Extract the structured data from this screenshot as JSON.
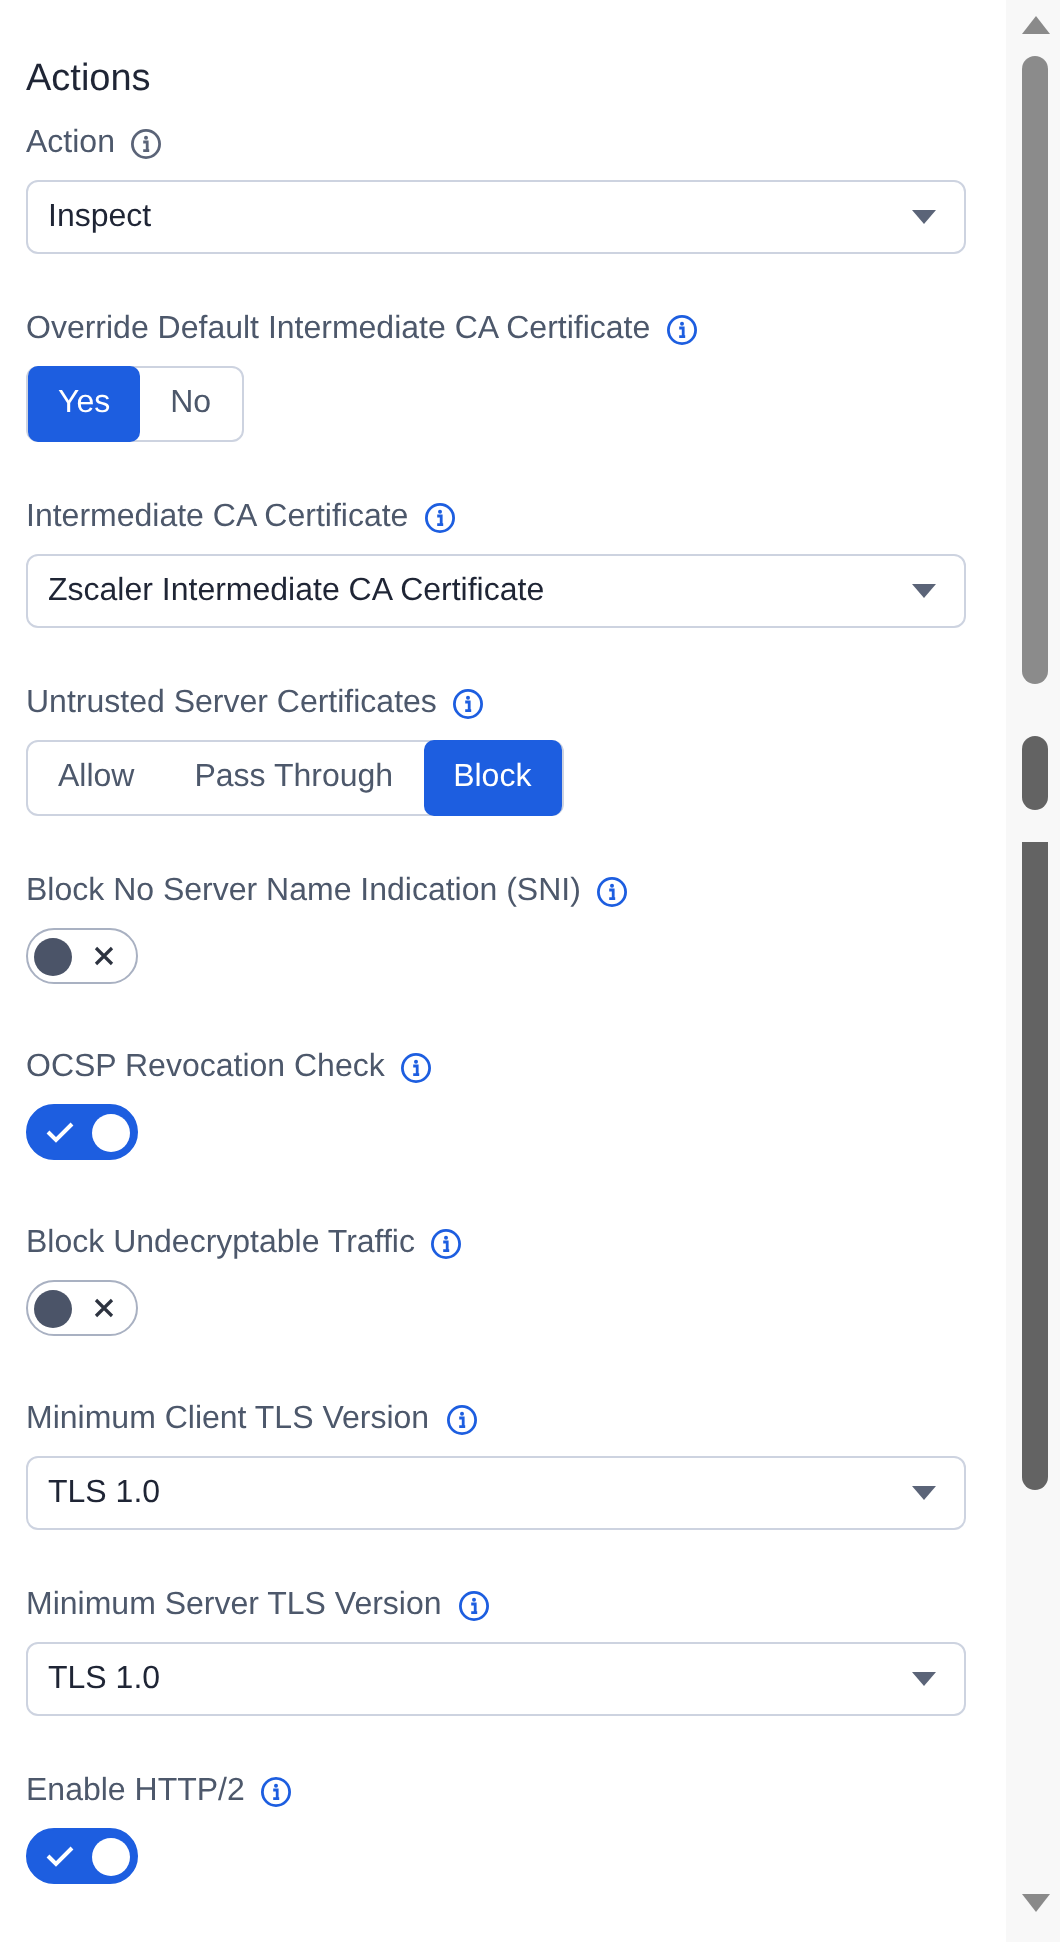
{
  "section_title": "Actions",
  "fields": [
    {
      "kind": "select",
      "label": "Action",
      "info_icon": {
        "color": "#5b6478"
      },
      "value": "Inspect"
    },
    {
      "kind": "segmented",
      "label": "Override Default Intermediate CA Certificate",
      "info_icon": {
        "color": "#1d5ee0"
      },
      "options": [
        {
          "label": "Yes",
          "selected": true
        },
        {
          "label": "No",
          "selected": false
        }
      ]
    },
    {
      "kind": "select",
      "label": "Intermediate CA Certificate",
      "info_icon": {
        "color": "#1d5ee0"
      },
      "value": "Zscaler Intermediate CA Certificate"
    },
    {
      "kind": "segmented",
      "label": "Untrusted Server Certificates",
      "info_icon": {
        "color": "#1d5ee0"
      },
      "options": [
        {
          "label": "Allow",
          "selected": false
        },
        {
          "label": "Pass Through",
          "selected": false
        },
        {
          "label": "Block",
          "selected": true
        }
      ]
    },
    {
      "kind": "toggle",
      "label": "Block No Server Name Indication (SNI)",
      "info_icon": {
        "color": "#1d5ee0"
      },
      "on": false
    },
    {
      "kind": "toggle",
      "label": "OCSP Revocation Check",
      "info_icon": {
        "color": "#1d5ee0"
      },
      "on": true
    },
    {
      "kind": "toggle",
      "label": "Block Undecryptable Traffic",
      "info_icon": {
        "color": "#1d5ee0"
      },
      "on": false
    },
    {
      "kind": "select",
      "label": "Minimum Client TLS Version",
      "info_icon": {
        "color": "#1d5ee0"
      },
      "value": "TLS 1.0"
    },
    {
      "kind": "select",
      "label": "Minimum Server TLS Version",
      "info_icon": {
        "color": "#1d5ee0"
      },
      "value": "TLS 1.0"
    },
    {
      "kind": "toggle",
      "label": "Enable HTTP/2",
      "info_icon": {
        "color": "#1d5ee0"
      },
      "on": true
    }
  ]
}
